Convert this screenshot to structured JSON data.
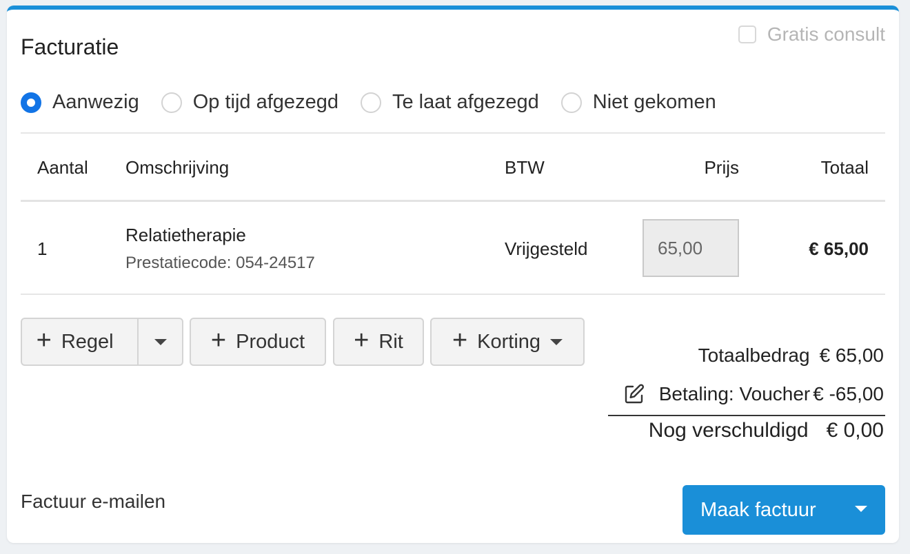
{
  "panel": {
    "title": "Facturatie",
    "gratis_label": "Gratis consult",
    "gratis_checked": false
  },
  "attendance": {
    "options": [
      "Aanwezig",
      "Op tijd afgezegd",
      "Te laat afgezegd",
      "Niet gekomen"
    ],
    "selected": "Aanwezig"
  },
  "table": {
    "headers": [
      "Aantal",
      "Omschrijving",
      "BTW",
      "Prijs",
      "Totaal"
    ],
    "rows": [
      {
        "aantal": "1",
        "omschrijving": "Relatietherapie",
        "prestatiecode": "Prestatiecode: 054-24517",
        "btw": "Vrijgesteld",
        "prijs": "65,00",
        "totaal": "€ 65,00"
      }
    ]
  },
  "actions": {
    "regel": "Regel",
    "product": "Product",
    "rit": "Rit",
    "korting": "Korting"
  },
  "summary": {
    "totaal_label": "Totaalbedrag",
    "totaal_value": "€ 65,00",
    "betaling_label": "Betaling: Voucher",
    "betaling_value": "€ -65,00",
    "schuld_label": "Nog verschuldigd",
    "schuld_value": "€ 0,00"
  },
  "footer": {
    "email_label": "Factuur e-mailen",
    "primary_label": "Maak factuur"
  },
  "colors": {
    "accent": "#1a8fd8",
    "radio_selected": "#1274e6"
  }
}
